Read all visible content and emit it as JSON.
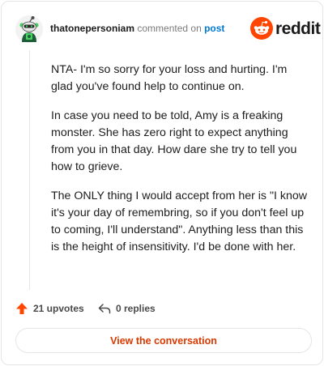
{
  "comment": {
    "username": "thatonepersoniam",
    "action_text": "commented on",
    "post_link": "post",
    "paragraphs": [
      "NTA- I'm so sorry for your loss and hurting. I'm glad you've found help to continue on.",
      "In case you need to be told, Amy is a freaking monster. She has zero right to expect anything from you in that day. How dare she try to tell you how to grieve.",
      "The ONLY thing I would accept from her is \"I know it's your day of remembring, so if you don't feel up to coming, I'll understand\". Anything less than this is the height of insensitivity. I'd be done with her."
    ]
  },
  "brand": {
    "wordmark": "reddit",
    "color": "#ff4500"
  },
  "stats": {
    "upvotes": "21 upvotes",
    "replies": "0 replies"
  },
  "actions": {
    "view_conversation": "View the conversation"
  },
  "icons": {
    "avatar": "snoo-avatar",
    "upvote": "upvote-arrow-icon",
    "reply": "reply-arrow-icon",
    "logo": "reddit-logo-icon"
  }
}
